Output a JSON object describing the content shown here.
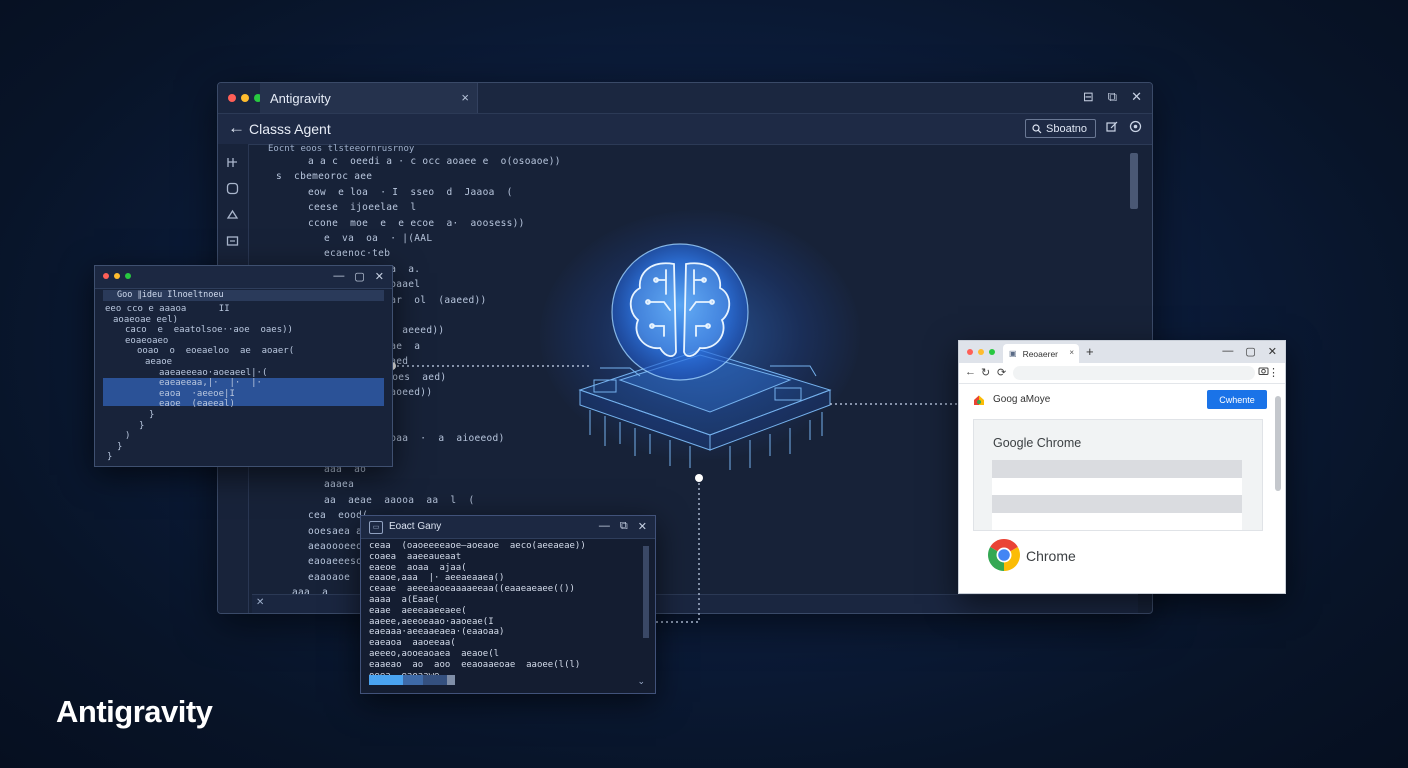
{
  "brand": {
    "name": "Antigravity"
  },
  "colors": {
    "accent": "#1a73e8",
    "glow": "#3c8cff",
    "background": "#0c1d3d"
  },
  "main_window": {
    "tab_title": "Antigravity",
    "tab_close": "×",
    "window_controls": [
      "⊟",
      "⧉",
      "✕"
    ],
    "toolbar": {
      "back_icon": "←",
      "title": "Classs Agent",
      "search_label": "Sboatno",
      "icons": [
        "edit-icon",
        "settings-icon"
      ]
    },
    "activity_icons": [
      "git-icon",
      "extensions-icon",
      "bell-icon",
      "folder-icon"
    ],
    "breadcrumb": "Eocnt eoos tlsteeornrusrnoy",
    "code_lines": [
      "a a c  oeedi a · c occ aoaee e  o(osoaoe))",
      "s  cbemeoroc aee",
      "eow  e loa  · I  sseo  d  Jaaoa  (",
      "ceese  ijoeelae  l",
      "ccone  moe  e  e ecoe  a·  aoosess))",
      "e  va  oa  · |(AAL",
      "ecaenoc·teb",
      "ceoaeo  aoaa  a.",
      "coetacntlaeoaael",
      "aeeaeaaoe  ar  ol  (aaeed))",
      "a  c  eoae",
      "aaaoaoo  aa  aeeed))",
      "a  aaa  oedae  a",
      "eseaeeoeoosaed",
      "aaa  aoaeeoes  aed)",
      "aeee aa  oeaoeed))",
      ".aoi",
      "aa  iaal.",
      "aa  oeoaa  oaa  ·  a  aioeeod)",
      "aaa  (",
      "aaa  ao",
      "aaaea",
      "aa  aeae  aaooa  aa  l  (",
      "cea  eood(",
      "ooesaea aaesooe",
      "aeaoooeeoaoed(",
      "eaoaeeeso eao)",
      "eaaoaoe  aaaoueoe  (ea  aeeod)",
      "aaa  a"
    ]
  },
  "left_window": {
    "window_controls": [
      "—",
      "▢",
      "✕"
    ],
    "header": "Goo ∥ideu Ilnoeltnoeu",
    "code_lines": [
      "eeo cco e aaaoa      II",
      "aoaeoae eel)",
      "caco  e  eaatolsoe··aoe  oaes))",
      "eoaeoaeo",
      "ooao  o  eoeaeloo  ae  aoaer(",
      "aeaoe",
      "aaeaeeeao·aoeaeel|·(",
      "eaeaeeaa,|·  |·  |·",
      "eaoa  ·aeeoe|I",
      "eaoe  (eaeeal)",
      "}",
      "}",
      ")",
      "}",
      "}"
    ]
  },
  "terminal_window": {
    "title": "Eoact Gany",
    "window_controls": [
      "—",
      "⧉",
      "✕"
    ],
    "lines": [
      "ceaa  (oaoeeeeaoe–aoeaoe  aeco(aeeaeae))",
      "coaea  aaeeaueaat",
      "eaeoe  aoaa  ajaa(",
      "eaaoe,aaa  |· aeeaeaaea()",
      "ceaae  aeeeaaoeaaaaeeaa((eaaeaeaee(())",
      "aaaa  a(Eaae(",
      "eaae  aeeeaaeeaee(",
      "aaeee,aeeoeaao·aaoeae(I",
      "eaeaaa·aeeaaeaea·(eaaoaa)",
      "eaeaoa  aaoeeaa(",
      "aeeeo,aooeaoaea  aeaoe(l",
      "eaaeao  ao  aoo  eeaoaaeoae  aaoee(l(l)",
      "oeea  eaoaawe"
    ]
  },
  "chrome_window": {
    "tab_title": "Reoaerer",
    "tab_close": "×",
    "new_tab": "+",
    "window_controls": [
      "—",
      "▢",
      "✕"
    ],
    "nav_icons": [
      "←",
      "↻",
      "⟳"
    ],
    "site_name": "Goog aMoye",
    "button_label": "Cwhente",
    "card_title": "Google Chrome",
    "product_name": "Chrome",
    "logo_colors": [
      "#ea4335",
      "#fbbc05",
      "#34a853",
      "#4285f4"
    ]
  }
}
